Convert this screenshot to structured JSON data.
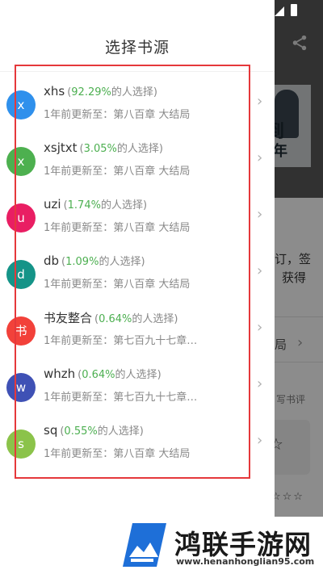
{
  "drawer": {
    "title": "选择书源"
  },
  "sources": [
    {
      "avatar": "x",
      "color": "#2f90ec",
      "name": "xhs",
      "pct": "92.29%",
      "suffix": "的人选择",
      "update": "1年前更新至：第八百章 大结局"
    },
    {
      "avatar": "x",
      "color": "#4db04f",
      "name": "xsjtxt",
      "pct": "3.05%",
      "suffix": "的人选择",
      "update": "1年前更新至：第八百章 大结局"
    },
    {
      "avatar": "u",
      "color": "#e91e63",
      "name": "uzi",
      "pct": "1.74%",
      "suffix": "的人选择",
      "update": "1年前更新至：第八百章 大结局"
    },
    {
      "avatar": "d",
      "color": "#159488",
      "name": "db",
      "pct": "1.09%",
      "suffix": "的人选择",
      "update": "1年前更新至：第八百章 大结局"
    },
    {
      "avatar": "书",
      "color": "#f2413a",
      "name": "书友整合",
      "pct": "0.64%",
      "suffix": "的人选择",
      "update": "1年前更新至：第七百九十七章…"
    },
    {
      "avatar": "w",
      "color": "#3f51b5",
      "name": "whzh",
      "pct": "0.64%",
      "suffix": "的人选择",
      "update": "1年前更新至：第七百九十七章…"
    },
    {
      "avatar": "s",
      "color": "#8bc34a",
      "name": "sq",
      "pct": "0.55%",
      "suffix": "的人选择",
      "update": "1年前更新至：第八百章 大结局"
    }
  ],
  "background": {
    "cover_line1": "签到",
    "cover_line2": "十年",
    "text1": "订，签",
    "text2": "获得",
    "text3": "局",
    "text4": "写书评"
  },
  "footer": {
    "brand": "鸿联手游网",
    "url": "www.henanhonglian95.com"
  },
  "icons": {
    "share": "share-icon",
    "chevron": "chevron-right-icon",
    "signal": "signal-icon",
    "battery": "battery-icon"
  }
}
